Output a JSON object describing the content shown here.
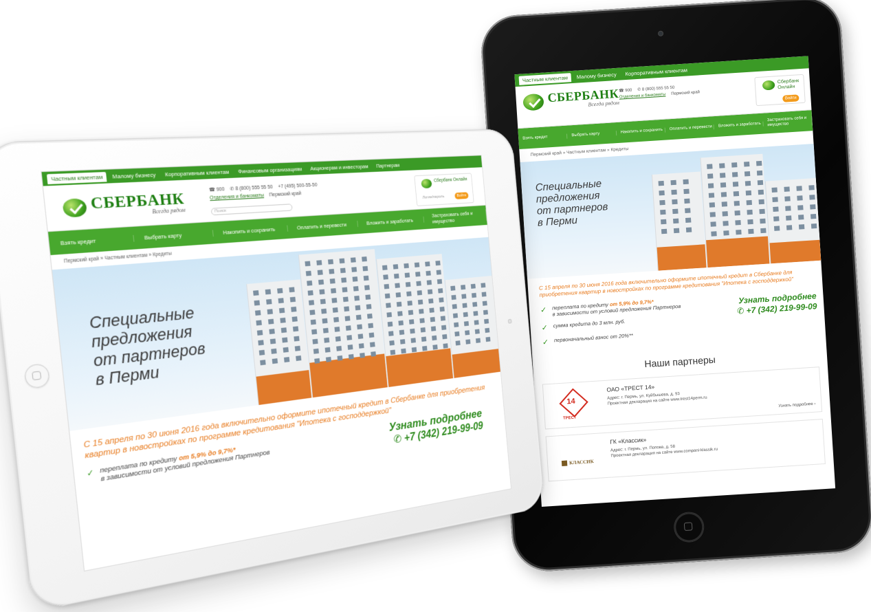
{
  "site": {
    "top_nav": [
      "Частным клиентам",
      "Малому бизнесу",
      "Корпоративным клиентам",
      "Финансовым организациям",
      "Акционерам и инвесторам",
      "Партнерам"
    ],
    "logo_text": "СБЕРБАНК",
    "logo_tagline": "Всегда рядом",
    "phone_short": "☎ 900",
    "phone_1": "✆ 8 (800) 555 55 50",
    "phone_2": "+7 (495) 500-55-50",
    "offices_link": "Отделения и банкоматы",
    "region": "Пермский край",
    "search_placeholder": "Поиск",
    "online_title": "Сбербанк Онлайн",
    "online_login": "Логин/пароль",
    "online_button": "Войти",
    "main_nav": [
      "Взять кредит",
      "Выбрать карту",
      "Накопить и сохранить",
      "Оплатить и перевести",
      "Вложить и заработать",
      "Застраховать себя и имущество"
    ],
    "breadcrumbs": "Пермский край » Частным клиентам » Кредиты",
    "banner_lines": [
      "Специальные",
      "предложения",
      "от партнеров",
      "в Перми"
    ],
    "promo_text": "С 15 апреля по 30 июня 2016 года включительно оформите ипотечный кредит в Сбербанке для приобретения квартир в новостройках по программе кредитования \"Ипотека с господдержкой\"",
    "bullet_1_prefix": "переплата по кредиту",
    "bullet_1_rate": "от 5,9% до 9,7%*",
    "bullet_1_note": "в зависимости от условий предложения Партнеров",
    "bullet_2": "сумма кредита до 3 млн. руб.",
    "bullet_3": "первоначальный взнос от 20%**",
    "learn_more": "Узнать подробнее",
    "phone_learn": "✆ +7 (342) 219-99-09",
    "partners_title": "Наши партнеры",
    "partner_1_name": "ОАО «ТРЕСТ 14»",
    "partner_1_address": "Адрес: г. Пермь, ул. Куйбышева, д. 93",
    "partner_1_site": "Проектная декларация на сайте www.trest14perm.ru",
    "partner_1_logo_num": "14",
    "partner_1_logo_cap": "ТРЕСТ",
    "partner_2_name": "ГК «Классик»",
    "partner_2_address": "Адрес: г. Пермь, ул. Попова, д. 58",
    "partner_2_site": "Проектная декларация на сайте www.compani-klassik.ru",
    "partner_2_logo": "КЛАССИК",
    "more_link": "Узнать подробнее ›"
  },
  "colors": {
    "brand_green": "#3b9a26",
    "accent_orange": "#e87d22",
    "tablet_black": "#0b0b0b",
    "tablet_white": "#f6f6f6"
  }
}
